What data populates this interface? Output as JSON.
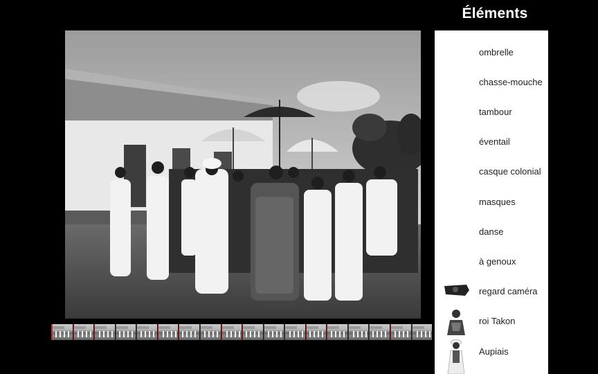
{
  "panel": {
    "title": "Éléments",
    "items": [
      {
        "label": "ombrelle",
        "icon": "none"
      },
      {
        "label": "chasse-mouche",
        "icon": "none"
      },
      {
        "label": "tambour",
        "icon": "none"
      },
      {
        "label": "éventail",
        "icon": "none"
      },
      {
        "label": "casque colonial",
        "icon": "none"
      },
      {
        "label": "masques",
        "icon": "none"
      },
      {
        "label": "danse",
        "icon": "none"
      },
      {
        "label": "à genoux",
        "icon": "none"
      },
      {
        "label": "regard caméra",
        "icon": "face-thumbnail-icon"
      },
      {
        "label": "roi Takon",
        "icon": "king-portrait-icon"
      },
      {
        "label": "Aupiais",
        "icon": "man-in-white-portrait-icon"
      }
    ]
  },
  "video": {
    "icon": "archival-film-frame"
  },
  "filmstrip": {
    "thumbnail_count": 18
  },
  "colors": {
    "background": "#000000",
    "panel": "#ffffff",
    "filmstrip_marker": "#b33333"
  }
}
